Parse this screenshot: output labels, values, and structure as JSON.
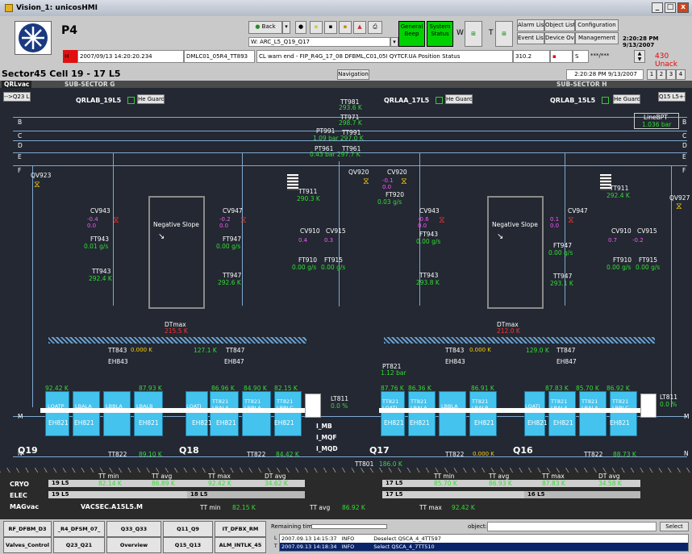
{
  "window": {
    "title": "Vision_1: unicosHMI",
    "controls": [
      "_",
      "□",
      "x"
    ]
  },
  "toolbar": {
    "title": "P4",
    "back": "Back",
    "general_beep": "General\nBeep",
    "system_status": "System\nStatus",
    "w_label": "W",
    "t_label": "T",
    "alarm_list": "Alarm List",
    "object_list": "Object List",
    "configuration": "Configuration",
    "event_list": "Event List",
    "device_ov": "Device Ov.",
    "management": "Management",
    "datetime": "2:20:28 PM 9/13/2007",
    "path": "W: ARC_L5_Q19_Q17"
  },
  "alarm_row": {
    "level": "H",
    "timestamp": "2007/09/13 14:20:20.234",
    "object": "DMLC01_05R4_TT893",
    "desc": "CL warn end - FIP_R4G_17_08 DFBML,C01,05I QYTCF.UA Position Status",
    "value": "310.2",
    "flag": "",
    "unit": "S",
    "ack_sym": "***/***",
    "unack": "430 Unack"
  },
  "header": {
    "sector": "Sector45 Cell 19 - 17 L5",
    "navigation": "Navigation",
    "datetime": "2:20:28 PM 9/13/2007",
    "pages": [
      "1",
      "2",
      "3",
      "4"
    ]
  },
  "subbar": {
    "qrlvac": "QRLvac",
    "sub_g": "SUB-SECTOR G",
    "sub_h": "SUB-SECTOR H",
    "btn_left": "-->Q23 L5",
    "btn_right": "Q15 L5+-"
  },
  "guards": [
    {
      "name": "QRLAB_19L5",
      "label": "He Guard"
    },
    {
      "name": "QRLAA_17L5",
      "label": "He Guard"
    },
    {
      "name": "QRLAB_15L5",
      "label": "He Guard"
    }
  ],
  "lines": {
    "b": "B",
    "c": "C",
    "d": "D",
    "e": "E",
    "f": "F",
    "m": "M",
    "n": "N"
  },
  "top_sensors": {
    "tt981": "TT981",
    "tt981_v": "293.6 K",
    "tt971": "TT971",
    "tt971_v": "298.7 K",
    "pt991": "PT991",
    "tt991": "TT991",
    "pt991_v": "1.09 bar 297.0 K",
    "pt961": "PT961",
    "tt961": "TT961",
    "pt961_v": "0.43 bar 297.7 K",
    "linebpt": "LineBPT",
    "linebpt_v": "1.036 bar"
  },
  "valves": {
    "qv923": "QV923",
    "qv920": "QV920",
    "cv920": "CV920",
    "cv920_v": "-0.1",
    "cv920_v2": "0.0",
    "ft920": "FT920",
    "ft920_v": "0.03 g/s",
    "qv927": "QV927"
  },
  "left": {
    "cv943": "CV943",
    "cv943_v": "-0.4",
    "cv943_v2": "0.0",
    "ft943": "FT943",
    "ft943_v": "0.01 g/s",
    "tt943": "TT943",
    "tt943_v": "292.4 K",
    "neg": "Negative Slope",
    "cv947": "CV947",
    "cv947_v": "-0.2",
    "cv947_v2": "0.0",
    "ft947": "FT947",
    "ft947_v": "0.00 g/s",
    "tt947": "TT947",
    "tt947_v": "292.6 K",
    "tt911": "TT911",
    "tt911_v": "290.3 K",
    "cv910": "CV910",
    "cv915": "CV915",
    "cv910_v": "0.4",
    "cv915_v": "0.3",
    "ft910": "FT910",
    "ft915": "FT915",
    "ft910_v": "0.00 g/s",
    "ft915_v": "0.00 g/s",
    "dtmax": "DTmax",
    "dtmax_v": "215.5 K",
    "tt843": "TT843",
    "tt843_v": "0.000 K",
    "eh843": "EH843",
    "tt847_v": "127.1 K",
    "tt847": "TT847",
    "eh847": "EH847"
  },
  "right": {
    "cv943": "CV943",
    "cv943_v": "-0.6",
    "cv943_v2": "0.0",
    "ft943": "FT943",
    "ft943_v": "0.00 g/s",
    "tt943": "TT943",
    "tt943_v": "293.8 K",
    "neg": "Negative Slope",
    "cv947": "CV947",
    "cv947_v": "0.1",
    "cv947_v2": "0.0",
    "ft947": "FT947",
    "ft947_v": "0.00 g/s",
    "tt947": "TT947",
    "tt947_v": "293.1 K",
    "tt911": "TT911",
    "tt911_v": "292.4 K",
    "cv910": "CV910",
    "cv915": "CV915",
    "cv910_v": "0.7",
    "cv915_v": "-0.2",
    "ft910": "FT910",
    "ft915": "FT915",
    "ft910_v": "0.00 g/s",
    "ft915_v": "0.00 g/s",
    "dtmax": "DTmax",
    "dtmax_v": "212.0 K",
    "tt843": "TT843",
    "tt843_v": "0.000 K",
    "eh843": "EH843",
    "tt847_v": "129.0 K",
    "tt847": "TT847",
    "eh847": "EH847"
  },
  "pt821": "PT821",
  "pt821_v": "1.12 bar",
  "magnets_left": {
    "temps": [
      "92.42 K",
      "87.93 K",
      "86.96 K",
      "84.90 K",
      "82.15 K"
    ],
    "labels": [
      "LQATP",
      "LBALA",
      "LBBLA",
      "LBALB",
      "LQATI",
      "TT821 LBALA",
      "TT821 LBBLA",
      "TT821 LBBLC"
    ],
    "tt822_v": "89.10 K",
    "tt822": "TT822",
    "tt822_v2": "84.42 K"
  },
  "magnets_right": {
    "temps": [
      "87.76 K",
      "86.36 K",
      "86.91 K",
      "87.83 K",
      "85.70 K",
      "86.92 K"
    ],
    "labels": [
      "TT821 LQATL",
      "TT821 LBALA",
      "LBBLA",
      "TT821 LBALB",
      "LQATI",
      "TT821 LBALA",
      "TT821 LBALA",
      "TT821 LBBLC"
    ],
    "tt822": "TT822",
    "tt822_v": "0.000 K",
    "tt822_v2": "88.73 K"
  },
  "eh821": "EH821",
  "lt811": {
    "name": "LT811",
    "value": "0.0 %"
  },
  "lt811_r": {
    "name": "LT811",
    "value": "0.0 %"
  },
  "quads": [
    "Q19",
    "Q18",
    "Q17",
    "Q16"
  ],
  "imb": [
    "I_MB",
    "I_MQF",
    "I_MQD"
  ],
  "tt801": "TT801",
  "tt801_v": "186.0 K",
  "summary": {
    "heads": [
      "TT min",
      "TT avg",
      "TT max",
      "DT avg"
    ],
    "cryo": "CRYO",
    "elec": "ELEC",
    "magvac": "MAGvac",
    "left_cell": "19 L5",
    "right_cell": "17 L5",
    "left_vals": [
      "82.14 K",
      "86.89 K",
      "92.42 K",
      "34.62 K"
    ],
    "right_vals": [
      "85.70 K",
      "86.93 K",
      "87.83 K",
      "34.58 K"
    ],
    "elec_left": "19 L5",
    "elec_mid": "18 L5",
    "elec_right": "17 L5",
    "elec_far": "16 L5",
    "magvac_name": "VACSEC.A15L5.M",
    "magvac_min_l": "TT min",
    "magvac_min": "82.15 K",
    "magvac_avg_l": "TT avg",
    "magvac_avg": "86.92 K",
    "magvac_max_l": "TT max",
    "magvac_max": "92.42 K"
  },
  "nav": {
    "row1": [
      "RF_DFBM_D3",
      "_R4_DFSM_07_",
      "Q33_Q33",
      "Q11_Q9",
      "IT_DFBX_RM"
    ],
    "row2": [
      "Valves_Control",
      "Q23_Q21",
      "Overview",
      "Q15_Q13",
      "ALM_INTLK_45"
    ]
  },
  "events": {
    "remaining": "Remaining time",
    "object": "object:",
    "select": "Select",
    "rows": [
      {
        "time": "2007.09.13 14:15:37",
        "lvl": "INFO",
        "msg": "Deselect QSCA_4_4TT597"
      },
      {
        "time": "2007.09.13 14:18:34",
        "lvl": "INFO",
        "msg": "Select QSCA_4_7TT510"
      }
    ],
    "l": "L",
    "t": "T"
  }
}
